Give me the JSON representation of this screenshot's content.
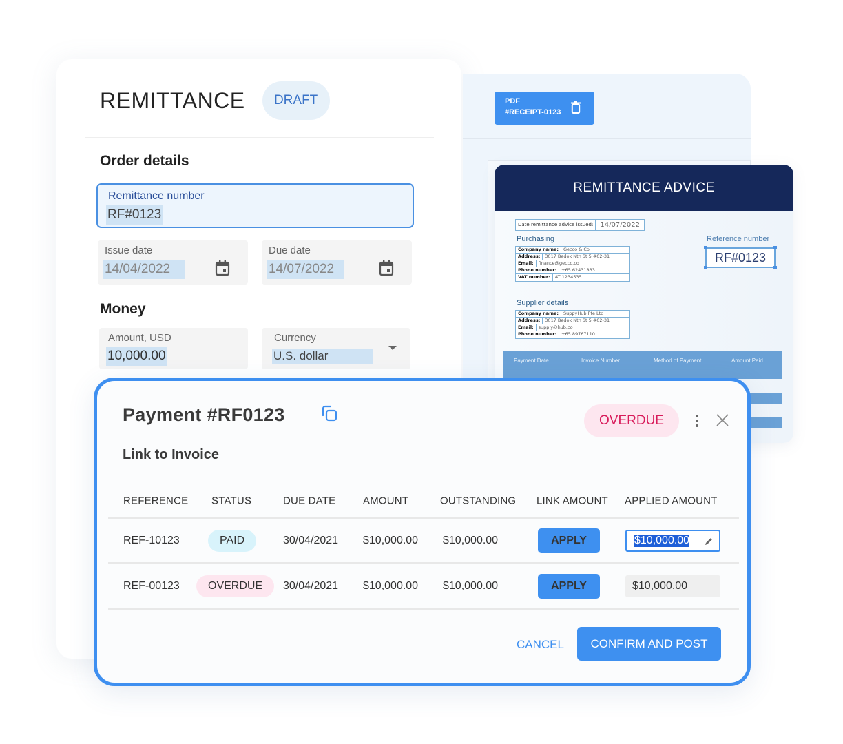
{
  "remittance": {
    "title": "REMITTANCE",
    "status_badge": "DRAFT",
    "order_section": "Order details",
    "remittance_number": {
      "label": "Remittance number",
      "value": "RF#0123"
    },
    "issue_date": {
      "label": "Issue date",
      "value": "14/04/2022",
      "icon": "calendar-icon"
    },
    "due_date": {
      "label": "Due date",
      "value": "14/07/2022",
      "icon": "calendar-icon"
    },
    "money_section": "Money",
    "amount": {
      "label": "Amount, USD",
      "value": "10,000.00"
    },
    "currency": {
      "label": "Currency",
      "value": "U.S. dollar",
      "icon": "chevron-down-icon"
    }
  },
  "pdf_panel": {
    "chip_line1": "PDF",
    "chip_line2": "#RECEIPT-0123",
    "chip_icon": "trash-icon",
    "advice": {
      "title": "REMITTANCE ADVICE",
      "issued_label": "Date remittance advice issued:",
      "issued_value": "14/07/2022",
      "purchasing_title": "Purchasing",
      "purchasing": [
        {
          "k": "Company name:",
          "v": "Gecco & Co"
        },
        {
          "k": "Address:",
          "v": "3017 Bedok Nth St 5 #02-31"
        },
        {
          "k": "Email:",
          "v": "finance@gecco.co"
        },
        {
          "k": "Phone number:",
          "v": "+65 62431833"
        },
        {
          "k": "VAT number:",
          "v": "AT 1234535"
        }
      ],
      "supplier_title": "Supplier details",
      "supplier": [
        {
          "k": "Company name:",
          "v": "SuppyHub Pte Ltd"
        },
        {
          "k": "Address:",
          "v": "3017 Bedok Nth St 5 #02-31"
        },
        {
          "k": "Email:",
          "v": "supply@hub.co"
        },
        {
          "k": "Phone number:",
          "v": "+65 89767110"
        }
      ],
      "reference_label": "Reference number",
      "reference_value": "RF#0123",
      "table_headers": [
        "Payment Date",
        "Invoice Number",
        "Method of Payment",
        "Amount Paid"
      ]
    }
  },
  "payment_modal": {
    "title": "Payment #RF0123",
    "copy_icon": "copy-icon",
    "status_badge": "OVERDUE",
    "more_icon": "more-vertical-icon",
    "close_icon": "close-icon",
    "subtitle": "Link to Invoice",
    "columns": [
      "REFERENCE",
      "STATUS",
      "DUE DATE",
      "AMOUNT",
      "OUTSTANDING",
      "LINK AMOUNT",
      "APPLIED AMOUNT"
    ],
    "rows": [
      {
        "reference": "REF-10123",
        "status": "PAID",
        "due_date": "30/04/2021",
        "amount": "$10,000.00",
        "outstanding": "$10,000.00",
        "link_label": "APPLY",
        "applied": "$10,000.00"
      },
      {
        "reference": "REF-00123",
        "status": "OVERDUE",
        "due_date": "30/04/2021",
        "amount": "$10,000.00",
        "outstanding": "$10,000.00",
        "link_label": "APPLY",
        "applied": "$10,000.00"
      }
    ],
    "cancel_label": "CANCEL",
    "confirm_label": "CONFIRM AND POST"
  },
  "colors": {
    "accent": "#3e90f0",
    "navy": "#15285a",
    "paid": "#16939e",
    "overdue": "#d81b5a"
  }
}
